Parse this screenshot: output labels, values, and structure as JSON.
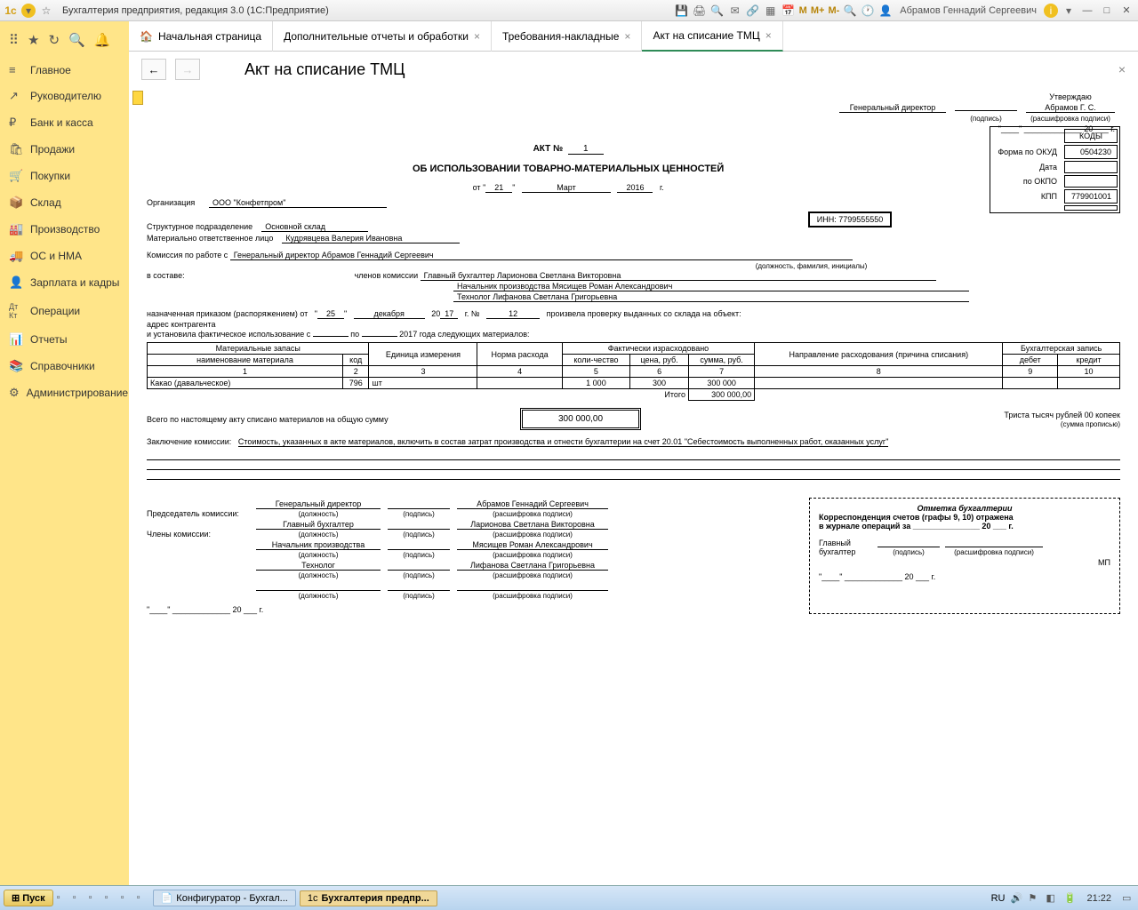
{
  "titlebar": {
    "title": "Бухгалтерия предприятия, редакция 3.0  (1С:Предприятие)",
    "user": "Абрамов Геннадий Сергеевич",
    "m_btns": [
      "M",
      "M+",
      "M-"
    ]
  },
  "tabs": [
    {
      "label": "Начальная страница",
      "home": true,
      "closable": false
    },
    {
      "label": "Дополнительные отчеты и обработки",
      "closable": true
    },
    {
      "label": "Требования-накладные",
      "closable": true
    },
    {
      "label": "Акт на списание ТМЦ",
      "closable": true,
      "active": true
    }
  ],
  "sidebar": [
    {
      "icon": "≡",
      "label": "Главное"
    },
    {
      "icon": "↗",
      "label": "Руководителю"
    },
    {
      "icon": "₽",
      "label": "Банк и касса"
    },
    {
      "icon": "🛍",
      "label": "Продажи"
    },
    {
      "icon": "🛒",
      "label": "Покупки"
    },
    {
      "icon": "📦",
      "label": "Склад"
    },
    {
      "icon": "🏭",
      "label": "Производство"
    },
    {
      "icon": "🚚",
      "label": "ОС и НМА"
    },
    {
      "icon": "👤",
      "label": "Зарплата и кадры"
    },
    {
      "icon": "Дт",
      "label": "Операции"
    },
    {
      "icon": "📊",
      "label": "Отчеты"
    },
    {
      "icon": "📚",
      "label": "Справочники"
    },
    {
      "icon": "⚙",
      "label": "Администрирование"
    }
  ],
  "doc": {
    "page_title": "Акт на списание ТМЦ",
    "approve": {
      "title": "Утверждаю",
      "position": "Генеральный директор",
      "name": "Абрамов Г. С.",
      "sub_sign": "(подпись)",
      "sub_name": "(расшифровка подписи)",
      "year_suffix": "20 ___ г."
    },
    "act_no_label": "АКТ №",
    "act_no": "1",
    "subtitle": "ОБ ИСПОЛЬЗОВАНИИ ТОВАРНО-МАТЕРИАЛЬНЫХ ЦЕННОСТЕЙ",
    "date": {
      "ot": "от",
      "day": "21",
      "month": "Март",
      "year": "2016",
      "g": "г."
    },
    "codes": {
      "okud_label": "Форма по ОКУД",
      "okud": "0504230",
      "date_label": "Дата",
      "okpo_label": "по ОКПО",
      "kpp_label": "КПП",
      "kpp": "779901001",
      "kody": "КОДЫ"
    },
    "inn_label": "ИНН:",
    "inn": "7799555550",
    "org_label": "Организация",
    "org": "ООО \"Конфетпром\"",
    "division_label": "Структурное подразделение",
    "division": "Основной склад",
    "responsible_label": "Материально ответственное лицо",
    "responsible": "Кудрявцева Валерия Ивановна",
    "commission_head_label": "Комиссия по работе с",
    "commission_head": "Генеральный директор  Абрамов Геннадий Сергеевич",
    "commission_sub": "(должность, фамилия, инициалы)",
    "members_label": "в составе:",
    "members_sub_label": "членов комиссии",
    "members": [
      "Главный бухгалтер  Ларионова Светлана Викторовна",
      "Начальник производства  Мясищев Роман Александрович",
      "Технолог Лифанова Светлана Григорьевна"
    ],
    "order_label": "назначенная приказом (распоряжением) от",
    "order_day": "25",
    "order_month": "декабря",
    "order_year_prefix": "20",
    "order_year": "17",
    "order_no_label": "г.   №",
    "order_no": "12",
    "order_text": "произвела проверку выданных со склада на объект:",
    "address_label": "адрес контрагента",
    "usage_label": "и установила фактическое использование с",
    "usage_po": "по",
    "usage_text": "2017 года следующих материалов:",
    "table": {
      "headers": {
        "h1": "Материальные запасы",
        "h1a": "наименование материала",
        "h1b": "код",
        "h2": "Единица измерения",
        "h3": "Норма расхода",
        "h4": "Фактически израсходовано",
        "h4a": "коли-чество",
        "h4b": "цена, руб.",
        "h4c": "сумма, руб.",
        "h5": "Направление расходования (причина списания)",
        "h6": "Бухгалтерская запись",
        "h6a": "дебет",
        "h6b": "кредит"
      },
      "cols": [
        "1",
        "2",
        "3",
        "4",
        "5",
        "6",
        "7",
        "8",
        "9",
        "10"
      ],
      "rows": [
        {
          "name": "Какао (давальческое)",
          "code": "796",
          "unit": "шт",
          "norm": "",
          "qty": "1 000",
          "price": "300",
          "sum": "300 000",
          "dir": "",
          "debit": "",
          "credit": ""
        }
      ],
      "total_label": "Итого",
      "total": "300 000,00"
    },
    "total_text": "Всего по настоящему акту списано материалов на общую сумму",
    "total_sum": "300 000,00",
    "total_words": "Триста тысяч рублей 00 копеек",
    "total_words_sub": "(сумма прописью)",
    "conclusion_label": "Заключение комиссии:",
    "conclusion": "Стоимость, указанных в акте материалов, включить в состав затрат производства и отнести бухгалтерии на счет 20.01 \"Себестоимость выполненных работ, оказанных услуг\"",
    "sig": {
      "chairman_label": "Председатель комиссии:",
      "members_label": "Члены комиссии:",
      "rows": [
        {
          "pos": "Генеральный директор",
          "name": "Абрамов Геннадий Сергеевич"
        },
        {
          "pos": "Главный бухгалтер",
          "name": "Ларионова Светлана Викторовна"
        },
        {
          "pos": "Начальник производства",
          "name": "Мясищев Роман Александрович"
        },
        {
          "pos": "Технолог",
          "name": "Лифанова Светлана Григорьевна"
        },
        {
          "pos": "",
          "name": ""
        }
      ],
      "sub_pos": "(должность)",
      "sub_sign": "(подпись)",
      "sub_name": "(расшифровка подписи)",
      "date_suffix": "20 ___ г."
    },
    "accounting": {
      "title": "Отметка бухгалтерии",
      "text1": "Корреспонденция счетов (графы 9, 10) отражена",
      "text2": "в журнале операций за _______________ 20 ___   г.",
      "chief": "Главный бухгалтер",
      "sub_sign": "(подпись)",
      "sub_name": "(расшифровка подписи)",
      "mp": "МП",
      "date": "\"____\" _____________ 20 ___   г."
    }
  },
  "taskbar": {
    "start": "Пуск",
    "items": [
      {
        "label": "Конфигуратор - Бухгал..."
      },
      {
        "label": "Бухгалтерия предпр...",
        "active": true
      }
    ],
    "lang": "RU",
    "time": "21:22"
  }
}
